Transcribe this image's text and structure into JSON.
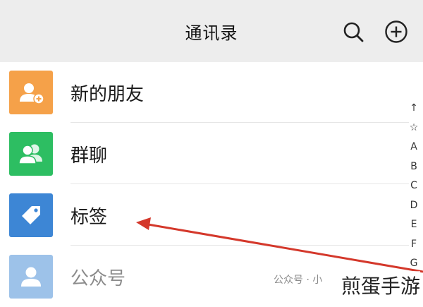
{
  "header": {
    "title": "通讯录",
    "search_icon": "search-icon",
    "add_icon": "plus-circle-icon"
  },
  "contacts_menu": [
    {
      "label": "新的朋友",
      "icon": "add-user-icon",
      "color": "#F5A149"
    },
    {
      "label": "群聊",
      "icon": "group-icon",
      "color": "#2DBE62"
    },
    {
      "label": "标签",
      "icon": "tag-icon",
      "color": "#3D86D5"
    },
    {
      "label": "公众号",
      "icon": "user-icon",
      "color": "#3D86D5"
    }
  ],
  "index_bar": [
    "↑",
    "☆",
    "A",
    "B",
    "C",
    "D",
    "E",
    "F",
    "G"
  ],
  "watermark": {
    "small": "公众号 · 小",
    "large": "煎蛋手游"
  },
  "annotation_arrow_color": "#D4382B"
}
